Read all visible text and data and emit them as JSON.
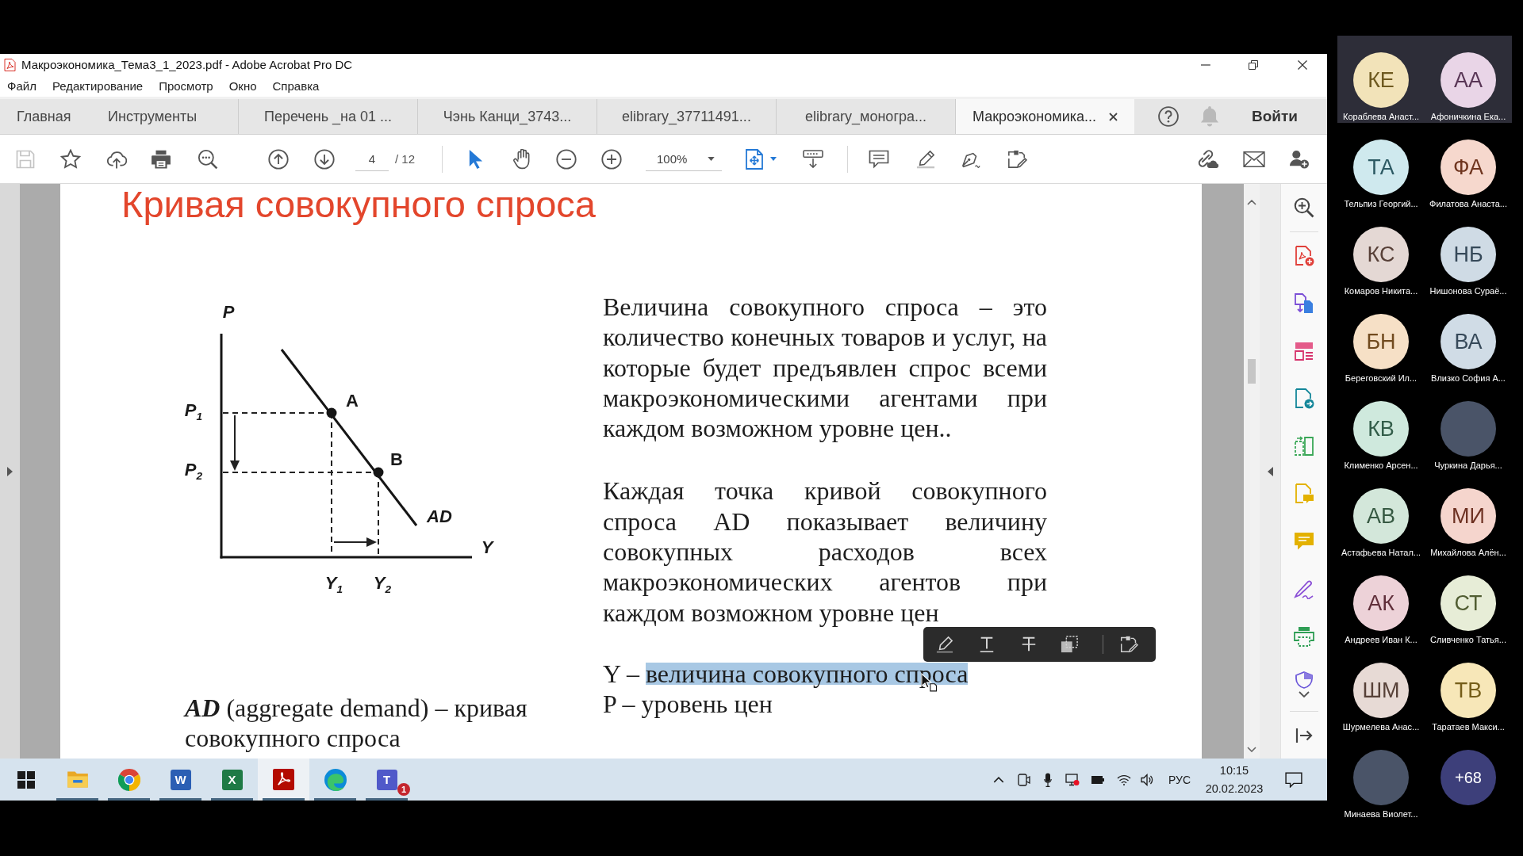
{
  "window": {
    "title": "Макроэкономика_Тема3_1_2023.pdf - Adobe Acrobat Pro DC"
  },
  "menu": [
    "Файл",
    "Редактирование",
    "Просмотр",
    "Окно",
    "Справка"
  ],
  "nav_tabs": [
    {
      "label": "Главная",
      "selected": false
    },
    {
      "label": "Инструменты",
      "selected": false
    }
  ],
  "document_tabs": [
    {
      "label": "Перечень _на 01 ...",
      "selected": false
    },
    {
      "label": "Чэнь Канци_3743...",
      "selected": false
    },
    {
      "label": "elibrary_37711491...",
      "selected": false
    },
    {
      "label": "elibrary_моногра...",
      "selected": false
    },
    {
      "label": "Макроэкономика...",
      "selected": true
    }
  ],
  "account": {
    "sign_in": "Войти"
  },
  "toolbar": {
    "save_disabled": true,
    "page": "4",
    "page_total": "/ 12",
    "zoom": "100%"
  },
  "page": {
    "title": "Кривая совокупного спроса",
    "figure": {
      "y_axis": "P",
      "x_axis": "Y",
      "curve": "AD",
      "points": [
        "A",
        "B"
      ],
      "price_levels": [
        "P$_{1}$",
        "P$_{2}$"
      ],
      "output_levels": [
        "Y$_{1}$",
        "Y$_{2}$"
      ]
    },
    "caption": "**AD** (aggregate demand) – кривая совокупного спроса",
    "paragraphs": [
      "Величина совокупного спроса – это количество конечных товаров и услуг, на которые будет предъявлен спрос всеми макроэкономическими агентами при каждом возможном уровне цен..",
      "Каждая точка кривой совокупного спроса AD показывает величину совокупных расходов всех макроэкономических агентов при каждом возможном уровне цен"
    ],
    "definitions": [
      {
        "segments": [
          {
            "text": "Y –",
            "selected": false
          },
          {
            "text": "величина совокупного спроса",
            "selected": true
          }
        ]
      },
      {
        "segments": [
          {
            "text": "P – уровень цен",
            "selected": false
          }
        ]
      }
    ]
  },
  "taskbar": {
    "apps": [
      {
        "kind": "start",
        "active": false,
        "running": false
      },
      {
        "kind": "explorer",
        "active": false,
        "running": true
      },
      {
        "kind": "chrome",
        "active": false,
        "running": true
      },
      {
        "kind": "word",
        "active": false,
        "running": true,
        "glyph": "W"
      },
      {
        "kind": "excel",
        "active": false,
        "running": true,
        "glyph": "X"
      },
      {
        "kind": "acrobat",
        "active": true,
        "running": true
      },
      {
        "kind": "edge",
        "active": false,
        "running": true
      },
      {
        "kind": "teams",
        "active": false,
        "running": true,
        "glyph": "T",
        "badge": "1"
      }
    ],
    "tray": {
      "language": "РУС",
      "time": "10:15",
      "date": "20.02.2023"
    }
  },
  "participants": [
    {
      "kind": "initials",
      "initials": "КЕ",
      "name": "Кораблева Анаст...",
      "color": "#f2e3b9",
      "highlighted": true
    },
    {
      "kind": "initials",
      "initials": "АА",
      "name": "Афоничкина Ека...",
      "color": "#e9d5e7",
      "highlighted": true
    },
    {
      "kind": "initials",
      "initials": "ТА",
      "name": "Тельпиз Георгий...",
      "color": "#cfe9ee",
      "highlighted": false
    },
    {
      "kind": "initials",
      "initials": "ФА",
      "name": "Филатова Анаста...",
      "color": "#f6d8cd",
      "highlighted": false
    },
    {
      "kind": "initials",
      "initials": "КС",
      "name": "Комаров Никита...",
      "color": "#e4d8d4",
      "highlighted": false
    },
    {
      "kind": "initials",
      "initials": "НБ",
      "name": "Нишонова Сураё...",
      "color": "#cfdbe5",
      "highlighted": false
    },
    {
      "kind": "initials",
      "initials": "БН",
      "name": "Береговский Ил...",
      "color": "#f6e0c6",
      "highlighted": false
    },
    {
      "kind": "initials",
      "initials": "ВА",
      "name": "Влизко София А...",
      "color": "#d0dce6",
      "highlighted": false
    },
    {
      "kind": "initials",
      "initials": "КВ",
      "name": "Клименко Арсен...",
      "color": "#cfe9dd",
      "highlighted": false
    },
    {
      "kind": "photo",
      "name": "Чуркина Дарья...",
      "highlighted": false
    },
    {
      "kind": "initials",
      "initials": "АВ",
      "name": "Астафьева Натал...",
      "color": "#d3e7da",
      "highlighted": false
    },
    {
      "kind": "initials",
      "initials": "МИ",
      "name": "Михайлова Алён...",
      "color": "#f5d5cd",
      "highlighted": false
    },
    {
      "kind": "initials",
      "initials": "АК",
      "name": "Андреев Иван К...",
      "color": "#edd2d8",
      "highlighted": false
    },
    {
      "kind": "initials",
      "initials": "СТ",
      "name": "Сливченко Татья...",
      "color": "#e7edd7",
      "highlighted": false
    },
    {
      "kind": "initials",
      "initials": "ШМ",
      "name": "Шурмелева Анас...",
      "color": "#e7dad5",
      "highlighted": false
    },
    {
      "kind": "initials",
      "initials": "ТВ",
      "name": "Таратаев Макси...",
      "color": "#f7e7b8",
      "highlighted": false
    },
    {
      "kind": "photo",
      "name": "Минаева Виолет...",
      "highlighted": false
    }
  ],
  "more_participants": {
    "label": "+68"
  }
}
